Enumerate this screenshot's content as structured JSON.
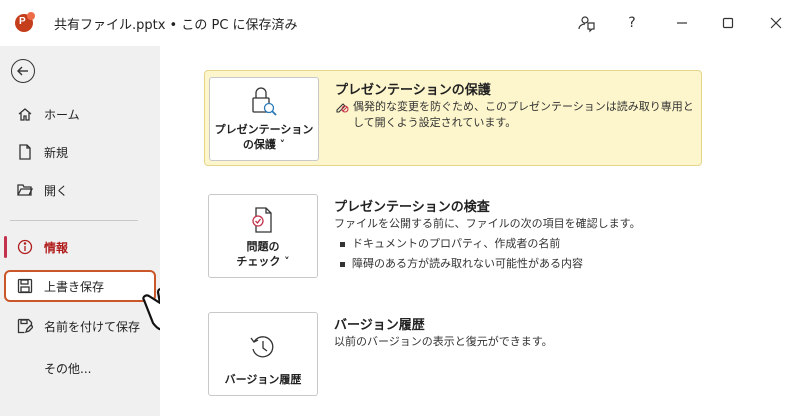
{
  "window": {
    "doc_title": "共有ファイル.pptx • この PC に保存済み"
  },
  "nav": {
    "items": [
      {
        "label": "ホーム"
      },
      {
        "label": "新規"
      },
      {
        "label": "開く"
      },
      {
        "label": "情報"
      },
      {
        "label": "上書き保存"
      },
      {
        "label": "名前を付けて保存"
      },
      {
        "label": "その他..."
      }
    ]
  },
  "protect": {
    "button_label": "プレゼンテーション\nの保護 ˅",
    "title": "プレゼンテーションの保護",
    "description": "偶発的な変更を防ぐため、このプレゼンテーションは読み取り専用として開くよう設定されています。"
  },
  "inspect": {
    "button_label": "問題の\nチェック ˅",
    "title": "プレゼンテーションの検査",
    "description": "ファイルを公開する前に、ファイルの次の項目を確認します。",
    "bullets": [
      "ドキュメントのプロパティ、作成者の名前",
      "障碍のある方が読み取れない可能性がある内容"
    ]
  },
  "version": {
    "button_label": "バージョン履歴",
    "title": "バージョン履歴",
    "description": "以前のバージョンの表示と復元ができます。"
  },
  "colors": {
    "accent": "#c4314b",
    "highlight_border": "#c9572a",
    "protect_bg": "#fdf6cc"
  },
  "icons": [
    "powerpoint-app-icon",
    "feedback-icon",
    "help-icon",
    "minimize-icon",
    "maximize-icon",
    "close-icon",
    "back-arrow-icon",
    "home-icon",
    "new-document-icon",
    "open-folder-icon",
    "info-icon",
    "save-icon",
    "save-as-icon",
    "lock-search-icon",
    "warning-edit-icon",
    "document-check-icon",
    "history-icon",
    "hand-cursor-icon"
  ]
}
